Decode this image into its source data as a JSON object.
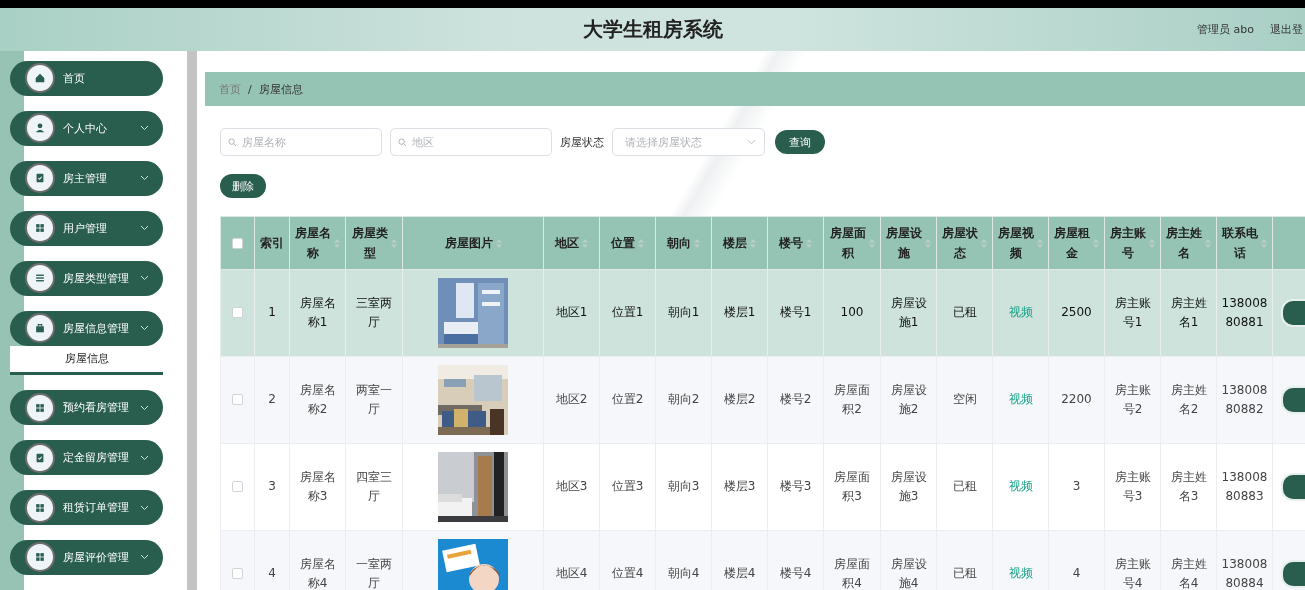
{
  "header": {
    "title": "大学生租房系统",
    "user": "管理员 abo",
    "logout": "退出登"
  },
  "sidebar": {
    "items": [
      {
        "label": "首页",
        "expanded": false
      },
      {
        "label": "个人中心",
        "expanded": false
      },
      {
        "label": "房主管理",
        "expanded": false
      },
      {
        "label": "用户管理",
        "expanded": false
      },
      {
        "label": "房屋类型管理",
        "expanded": false
      },
      {
        "label": "房屋信息管理",
        "expanded": true,
        "children": [
          {
            "label": "房屋信息",
            "selected": true
          }
        ]
      },
      {
        "label": "预约看房管理",
        "expanded": false
      },
      {
        "label": "定金留房管理",
        "expanded": false
      },
      {
        "label": "租赁订单管理",
        "expanded": false
      },
      {
        "label": "房屋评价管理",
        "expanded": false
      }
    ]
  },
  "breadcrumb": {
    "items": [
      "首页",
      "房屋信息"
    ],
    "separator": "/"
  },
  "search": {
    "name_placeholder": "房屋名称",
    "region_placeholder": "地区",
    "status_label": "房屋状态",
    "status_placeholder": "请选择房屋状态",
    "query_button": "查询"
  },
  "delete_button": "删除",
  "table": {
    "select_all_checked": false,
    "columns": [
      {
        "label": "索引",
        "sortable": false
      },
      {
        "label": "房屋名称",
        "sortable": true
      },
      {
        "label": "房屋类型",
        "sortable": true
      },
      {
        "label": "房屋图片",
        "sortable": true
      },
      {
        "label": "地区",
        "sortable": true
      },
      {
        "label": "位置",
        "sortable": true
      },
      {
        "label": "朝向",
        "sortable": true
      },
      {
        "label": "楼层",
        "sortable": true
      },
      {
        "label": "楼号",
        "sortable": true
      },
      {
        "label": "房屋面积",
        "sortable": true
      },
      {
        "label": "房屋设施",
        "sortable": true
      },
      {
        "label": "房屋状态",
        "sortable": true
      },
      {
        "label": "房屋视频",
        "sortable": true
      },
      {
        "label": "房屋租金",
        "sortable": true
      },
      {
        "label": "房主账号",
        "sortable": true
      },
      {
        "label": "房主姓名",
        "sortable": true
      },
      {
        "label": "联系电话",
        "sortable": true
      }
    ],
    "rows": [
      {
        "selected": true,
        "checked": false,
        "cells": [
          "1",
          "房屋名称1",
          "三室两厅",
          "",
          "地区1",
          "位置1",
          "朝向1",
          "楼层1",
          "楼号1",
          "100",
          "房屋设施1",
          "已租",
          "视频",
          "2500",
          "房主账号1",
          "房主姓名1",
          "13800880881"
        ]
      },
      {
        "selected": false,
        "checked": false,
        "cells": [
          "2",
          "房屋名称2",
          "两室一厅",
          "",
          "地区2",
          "位置2",
          "朝向2",
          "楼层2",
          "楼号2",
          "房屋面积2",
          "房屋设施2",
          "空闲",
          "视频",
          "2200",
          "房主账号2",
          "房主姓名2",
          "13800880882"
        ]
      },
      {
        "selected": false,
        "checked": false,
        "cells": [
          "3",
          "房屋名称3",
          "四室三厅",
          "",
          "地区3",
          "位置3",
          "朝向3",
          "楼层3",
          "楼号3",
          "房屋面积3",
          "房屋设施3",
          "已租",
          "视频",
          "3",
          "房主账号3",
          "房主姓名3",
          "13800880883"
        ]
      },
      {
        "selected": false,
        "checked": false,
        "cells": [
          "4",
          "房屋名称4",
          "一室两厅",
          "",
          "地区4",
          "位置4",
          "朝向4",
          "楼层4",
          "楼号4",
          "房屋面积4",
          "房屋设施4",
          "已租",
          "视频",
          "4",
          "房主账号4",
          "房主姓名4",
          "13800880884"
        ]
      }
    ]
  }
}
